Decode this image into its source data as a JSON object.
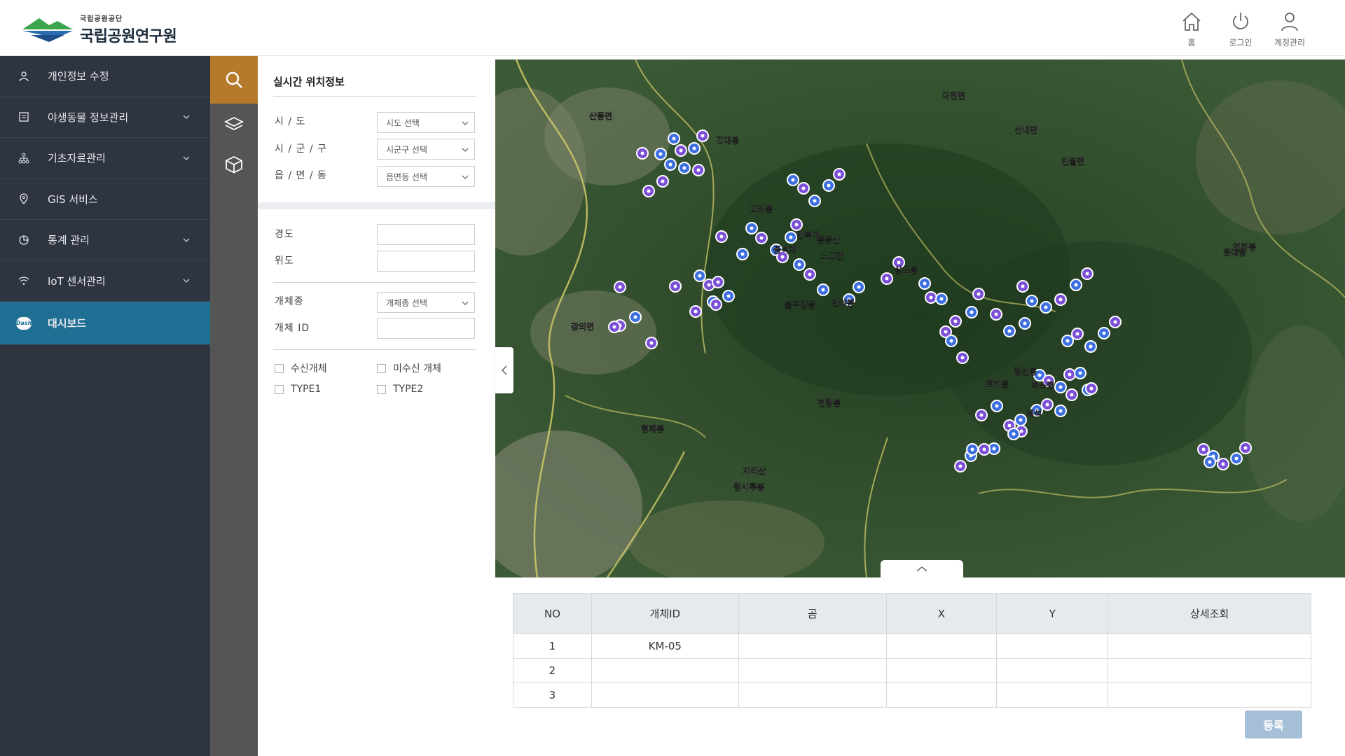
{
  "header": {
    "org_small": "국립공원공단",
    "org_name": "국립공원연구원",
    "menu": [
      {
        "label": "홈",
        "icon": "home-icon"
      },
      {
        "label": "로그인",
        "icon": "power-icon"
      },
      {
        "label": "계정관리",
        "icon": "user-icon"
      }
    ]
  },
  "sidebar": {
    "items": [
      {
        "label": "개인정보 수정",
        "icon": "person-icon",
        "expandable": false
      },
      {
        "label": "야생동물 정보관리",
        "icon": "document-icon",
        "expandable": true
      },
      {
        "label": "기초자료관리",
        "icon": "hierarchy-icon",
        "expandable": true
      },
      {
        "label": "GIS 서비스",
        "icon": "pin-icon",
        "expandable": false
      },
      {
        "label": "통계 관리",
        "icon": "pie-chart-icon",
        "expandable": true
      },
      {
        "label": "IoT 센서관리",
        "icon": "wifi-icon",
        "expandable": true
      },
      {
        "label": "대시보드",
        "icon": "dash-icon",
        "expandable": false,
        "active": true
      }
    ],
    "dash_badge": "Dash"
  },
  "rail": {
    "buttons": [
      "search-icon",
      "layers-icon",
      "cube-icon"
    ],
    "active": "search-icon"
  },
  "filter": {
    "title": "실시간 위치정보",
    "sido_label": "시 / 도",
    "sido_value": "시도 선택",
    "sigungu_label": "시 / 군 / 구",
    "sigungu_value": "시군구 선택",
    "emd_label": "읍 / 면 / 동",
    "emd_value": "읍면동 선택",
    "lon_label": "경도",
    "lon_value": "",
    "lat_label": "위도",
    "lat_value": "",
    "species_label": "개체종",
    "species_value": "개체종 선택",
    "id_label": "개체 ID",
    "id_value": "",
    "checks": [
      {
        "label": "수신개체"
      },
      {
        "label": "미수신 개체"
      },
      {
        "label": "TYPE1"
      },
      {
        "label": "TYPE2"
      }
    ]
  },
  "map": {
    "place_labels": [
      "깃대봉",
      "고리봉",
      "만복대",
      "노고단",
      "종석대",
      "봉동산",
      "불무장등",
      "반야봉",
      "천왕봉",
      "삼도봉",
      "토끼봉",
      "명선봉",
      "벽소령",
      "세석",
      "촛대봉",
      "연하봉",
      "지리산",
      "왕시루봉",
      "형제봉",
      "광의면",
      "산동면",
      "마천면",
      "산내면",
      "인월면"
    ],
    "marker_colors": {
      "received": "#3d6fe0",
      "unreceived": "#7b4fd6"
    }
  },
  "table": {
    "columns": [
      "NO",
      "개체ID",
      "곰",
      "X",
      "Y",
      "상세조회"
    ],
    "rows": [
      [
        "1",
        "KM-05",
        "",
        "",
        "",
        ""
      ],
      [
        "2",
        "",
        "",
        "",
        "",
        ""
      ],
      [
        "3",
        "",
        "",
        "",
        "",
        ""
      ]
    ],
    "register_label": "등록"
  }
}
